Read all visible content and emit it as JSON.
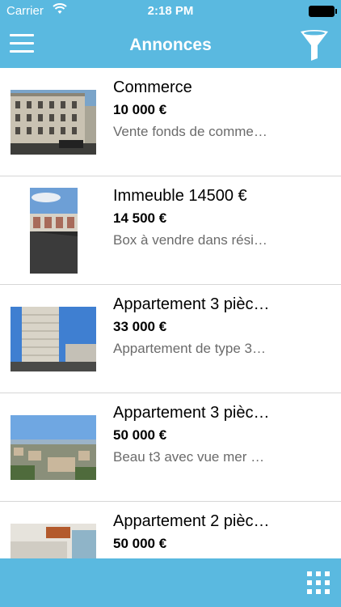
{
  "status_bar": {
    "carrier": "Carrier",
    "time": "2:18 PM"
  },
  "navbar": {
    "title": "Annonces",
    "menu_icon": "hamburger-icon",
    "filter_icon": "funnel-icon"
  },
  "listings": [
    {
      "title": "Commerce",
      "price": "10 000 €",
      "description": "Vente fonds de comme…"
    },
    {
      "title": "Immeuble 14500 €",
      "price": "14 500 €",
      "description": "Box à vendre dans rési…"
    },
    {
      "title": "Appartement 3 pièc…",
      "price": "33 000 €",
      "description": "Appartement de type 3…"
    },
    {
      "title": "Appartement 3 pièc…",
      "price": "50 000 €",
      "description": "Beau t3 avec vue mer …"
    },
    {
      "title": "Appartement 2 pièc…",
      "price": "50 000 €",
      "description": ""
    }
  ],
  "bottom_bar": {
    "grid_icon": "grid-view-icon"
  },
  "colors": {
    "accent": "#5ab9e0",
    "text": "#000000",
    "secondary_text": "#6b6b6b"
  }
}
